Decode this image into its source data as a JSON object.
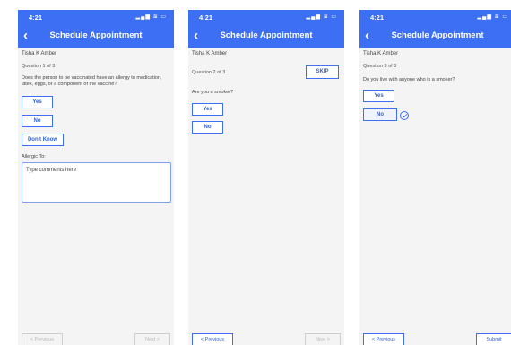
{
  "status": {
    "time": "4:21",
    "icons": "▂▄▆ ≋ ▭"
  },
  "header": {
    "title": "Schedule Appointment",
    "back": "‹"
  },
  "patient": {
    "name": "Tisha K Amber"
  },
  "screens": [
    {
      "question_number": "Question 1 of 3",
      "question": "Does the person to be vaccinated have an allergy to medication, latex, eggs, or a component of the vaccine?",
      "options": [
        "Yes",
        "No",
        "Don't Know"
      ],
      "allergy_label": "Allergic To:",
      "comment_placeholder": "Type comments here",
      "prev_label": "< Previous",
      "next_label": "Next >"
    },
    {
      "question_number": "Question 2 of 3",
      "skip_label": "SKIP",
      "question": "Are you a smoker?",
      "options": [
        "Yes",
        "No"
      ],
      "prev_label": "< Previous",
      "next_label": "Next >"
    },
    {
      "question_number": "Question 3 of 3",
      "question": "Do you live with anyone who is a smoker?",
      "options": [
        "Yes",
        "No"
      ],
      "selected": "No",
      "prev_label": "< Previous",
      "submit_label": "Submit"
    }
  ],
  "colors": {
    "accent": "#3d6ff5",
    "background": "#f4f4f4"
  }
}
